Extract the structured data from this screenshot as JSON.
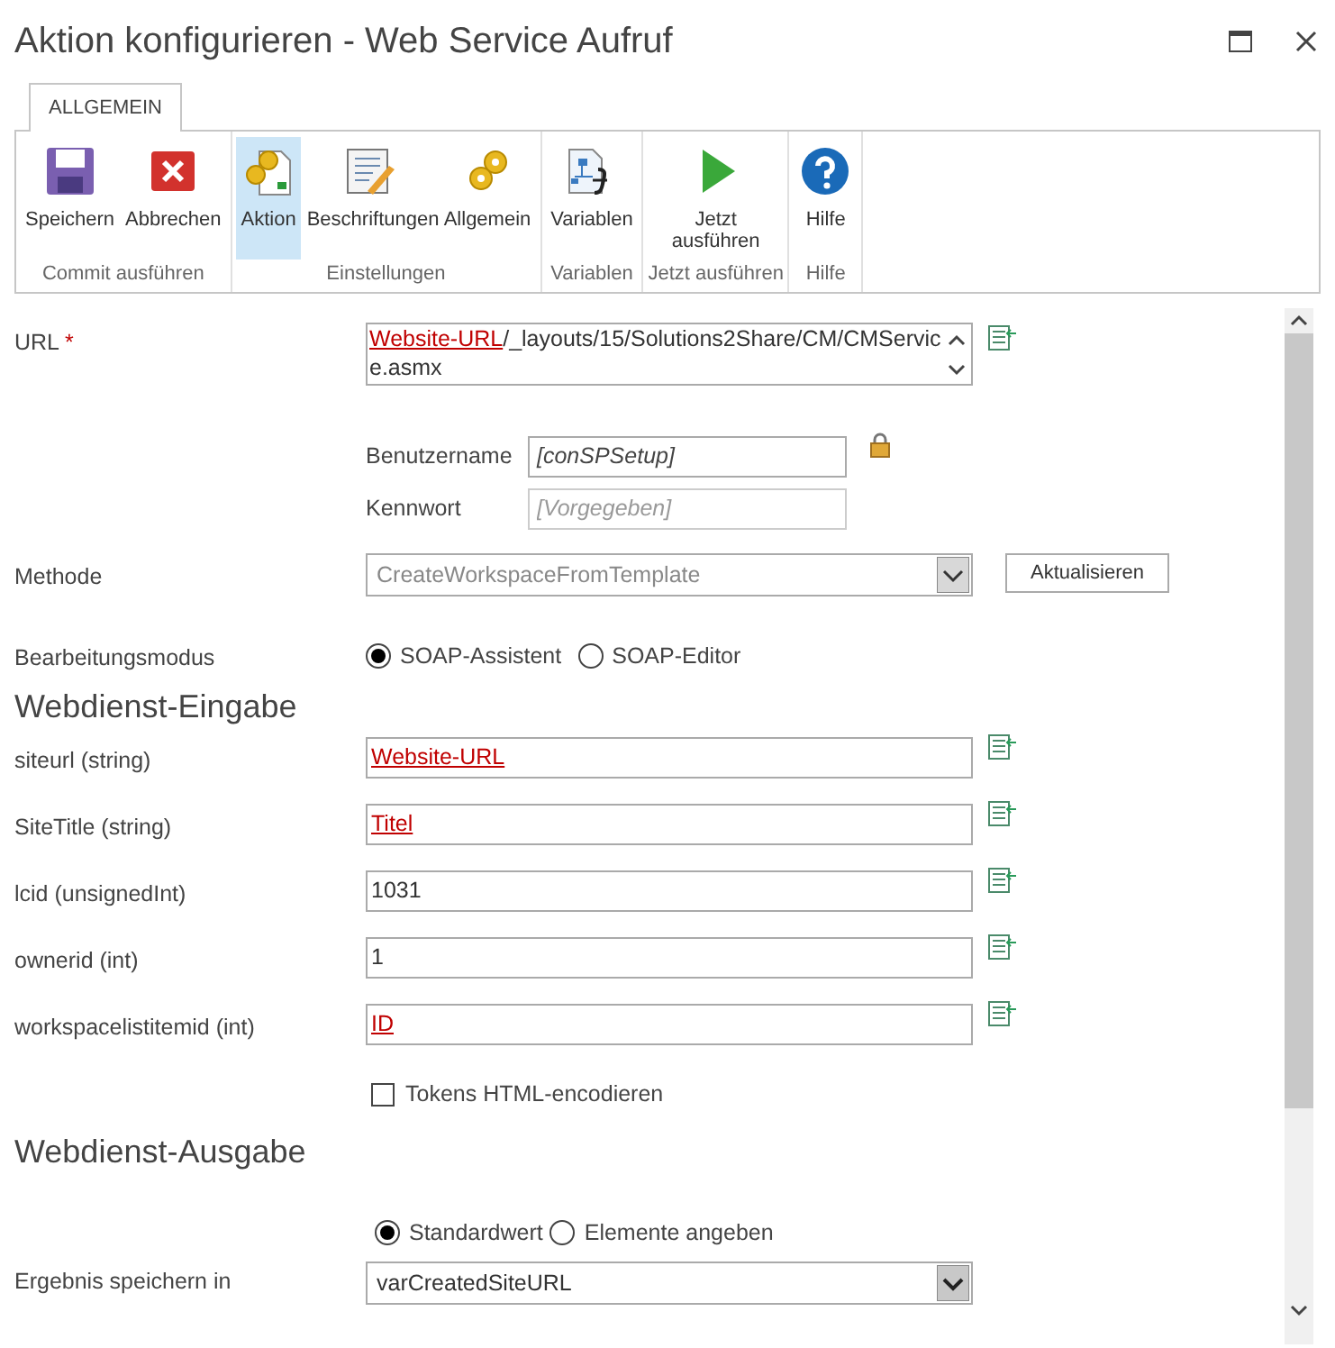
{
  "window": {
    "title": "Aktion konfigurieren - Web Service Aufruf"
  },
  "ribbon": {
    "tabs": [
      {
        "label": "ALLGEMEIN",
        "selected": true
      }
    ],
    "groups": [
      {
        "label": "Commit ausführen",
        "buttons": [
          {
            "label": "Speichern",
            "kind": "save",
            "selected": false
          },
          {
            "label": "Abbrechen",
            "kind": "cancel",
            "selected": false
          }
        ]
      },
      {
        "label": "Einstellungen",
        "buttons": [
          {
            "label": "Aktion",
            "kind": "action",
            "selected": true
          },
          {
            "label": "Beschriftungen",
            "kind": "labels",
            "selected": false
          },
          {
            "label": "Allgemein",
            "kind": "general",
            "selected": false
          }
        ]
      },
      {
        "label": "Variablen",
        "buttons": [
          {
            "label": "Variablen",
            "kind": "variables",
            "selected": false
          }
        ]
      },
      {
        "label": "Jetzt ausführen",
        "buttons": [
          {
            "label": "Jetzt ausführen",
            "kind": "run",
            "selected": false
          }
        ]
      },
      {
        "label": "Hilfe",
        "buttons": [
          {
            "label": "Hilfe",
            "kind": "help",
            "selected": false
          }
        ]
      }
    ]
  },
  "url": {
    "label": "URL",
    "required": "*",
    "parts": [
      {
        "text": "Website-URL",
        "kind": "token"
      },
      {
        "text": "/_layouts/15/Solutions2Share/CM/CMService.asmx",
        "kind": "plain"
      }
    ]
  },
  "credentials": {
    "username": {
      "label": "Benutzername",
      "value": "[conSPSetup]"
    },
    "password": {
      "label": "Kennwort",
      "placeholder": "[Vorgegeben]"
    }
  },
  "method": {
    "label": "Methode",
    "value": "CreateWorkspaceFromTemplate",
    "disabled": true,
    "button": "Aktualisieren"
  },
  "edit_mode": {
    "label": "Bearbeitungsmodus",
    "options": [
      {
        "label": "SOAP-Assistent",
        "selected": true
      },
      {
        "label": "SOAP-Editor",
        "selected": false
      }
    ]
  },
  "input_section": {
    "title": "Webdienst-Eingabe",
    "params": [
      {
        "label": "siteurl (string)",
        "value": "Website-URL",
        "kind": "token"
      },
      {
        "label": "SiteTitle (string)",
        "value": "Titel",
        "kind": "token"
      },
      {
        "label": "lcid (unsignedInt)",
        "value": "1031",
        "kind": "plain"
      },
      {
        "label": "ownerid (int)",
        "value": "1",
        "kind": "plain"
      },
      {
        "label": "workspacelistitemid (int)",
        "value": "ID",
        "kind": "token"
      }
    ],
    "checkbox": {
      "label": "Tokens HTML-encodieren",
      "checked": false
    }
  },
  "output_section": {
    "title": "Webdienst-Ausgabe",
    "options": [
      {
        "label": "Standardwert",
        "selected": true
      },
      {
        "label": "Elemente angeben",
        "selected": false
      }
    ],
    "result": {
      "label": "Ergebnis speichern in",
      "value": "varCreatedSiteURL"
    }
  }
}
